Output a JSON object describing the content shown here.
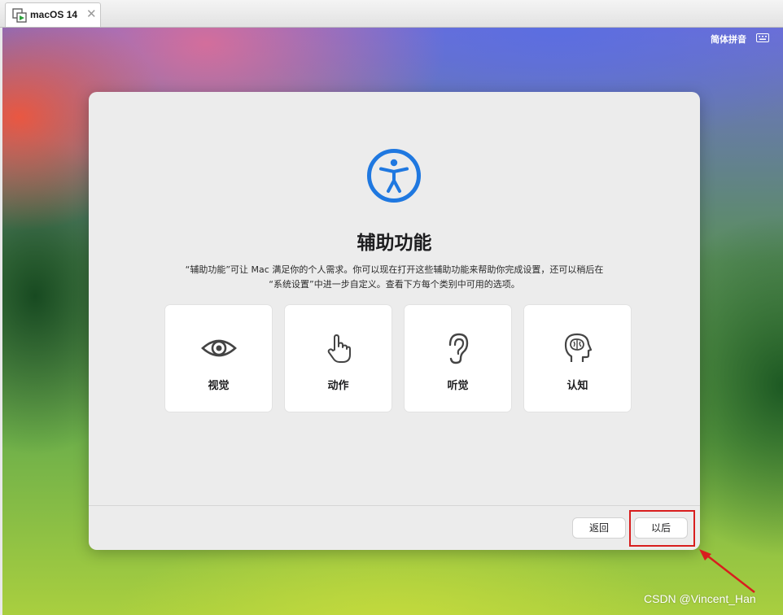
{
  "tab": {
    "label": "macOS 14",
    "close_glyph": "✕",
    "icon": "vm-icon"
  },
  "menubar": {
    "input_method": "简体拼音",
    "keyboard_icon": "keyboard-icon"
  },
  "dialog": {
    "icon": "accessibility-icon",
    "title": "辅助功能",
    "description_line1": "“辅助功能”可让 Mac 满足你的个人需求。你可以现在打开这些辅助功能来帮助你完成设置，还可以稍后在",
    "description_line2": "“系统设置”中进一步自定义。查看下方每个类别中可用的选项。",
    "categories": [
      {
        "label": "视觉",
        "icon": "eye-icon"
      },
      {
        "label": "动作",
        "icon": "hand-pointer-icon"
      },
      {
        "label": "听觉",
        "icon": "ear-icon"
      },
      {
        "label": "认知",
        "icon": "head-brain-icon"
      }
    ],
    "back_label": "返回",
    "later_label": "以后"
  },
  "annotation": {
    "highlight_color": "#d81e1e"
  },
  "watermark": "CSDN @Vincent_Han"
}
